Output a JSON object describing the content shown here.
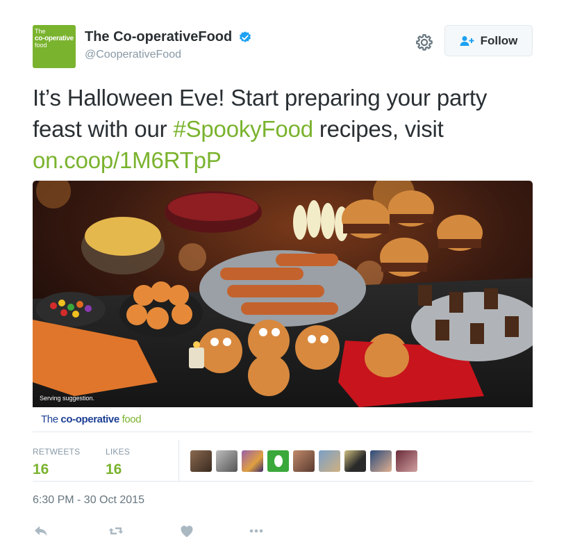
{
  "account": {
    "avatar_line1": "The",
    "avatar_line2": "co-operative",
    "avatar_line3": "food",
    "display_name": "The Co-operativeFood",
    "handle": "@CooperativeFood",
    "verified": true
  },
  "header": {
    "settings_icon": "gear-icon",
    "follow_label": "Follow",
    "follow_icon": "add-user-icon"
  },
  "tweet": {
    "text_before": "It’s Halloween Eve! Start preparing your party feast with our ",
    "hashtag": "#SpookyFood",
    "text_middle": " recipes, visit ",
    "link": "on.coop/1M6RTpP"
  },
  "media": {
    "caption": "Serving suggestion.",
    "brand_part1": "The ",
    "brand_part2": "co-operative",
    "brand_part3": " food"
  },
  "stats": {
    "retweets_label": "RETWEETS",
    "retweets_value": "16",
    "likes_label": "LIKES",
    "likes_value": "16",
    "liker_avatar_count": 9
  },
  "timestamp": "6:30 PM - 30 Oct 2015",
  "actions": [
    "reply-icon",
    "retweet-icon",
    "like-icon",
    "more-icon"
  ],
  "colors": {
    "brand_green": "#7ab32e",
    "link_green": "#7ab32e",
    "verified_blue": "#1da1f2",
    "muted_gray": "#8899a6",
    "text_dark": "#292f33",
    "brand_blue": "#1c3f94"
  }
}
